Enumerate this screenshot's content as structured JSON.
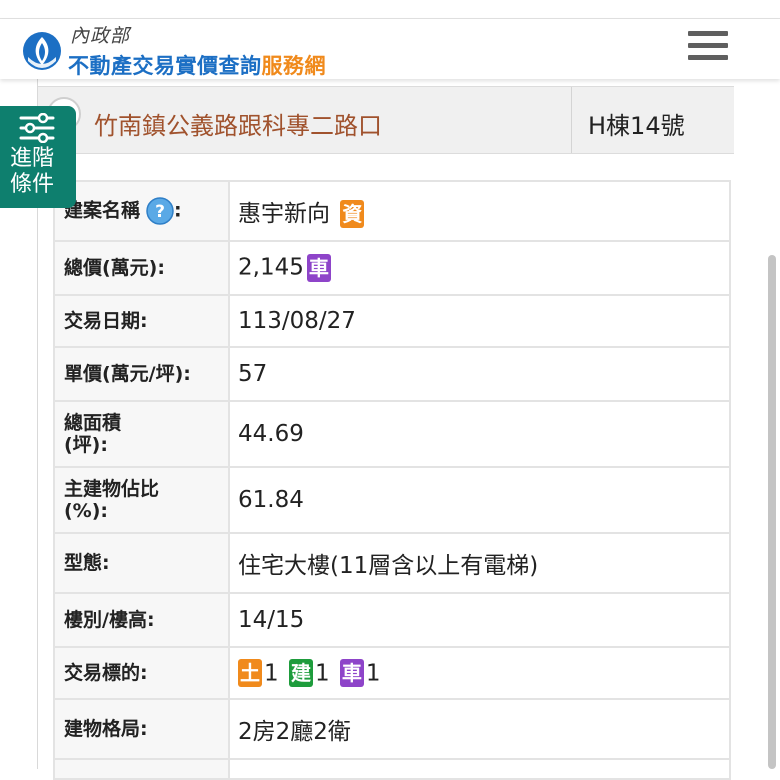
{
  "header": {
    "ministry": "內政部",
    "site_title_main": "不動產交易實價查詢",
    "site_title_accent": "服務網"
  },
  "advanced_filter": {
    "label": "進階條件"
  },
  "address_row": {
    "address": "竹南鎮公義路跟科專二路口",
    "unit": "H棟14號"
  },
  "details": {
    "project_name_label": "建案名稱",
    "project_name_colon": ":",
    "project_name_value": "惠宇新向",
    "project_badge": "資",
    "total_price_label": "總價(萬元):",
    "total_price_value": "2,145",
    "total_price_badge": "車",
    "date_label": "交易日期:",
    "date_value": "113/08/27",
    "unit_price_label": "單價(萬元/坪):",
    "unit_price_value": "57",
    "total_area_label": "總面積(坪):",
    "total_area_value": "44.69",
    "main_building_label": "主建物佔比(%):",
    "main_building_value": "61.84",
    "type_label": "型態:",
    "type_value": "住宅大樓(11層含以上有電梯)",
    "floor_label": "樓別/樓高:",
    "floor_value": "14/15",
    "target_label": "交易標的:",
    "targets": [
      {
        "badge": "土",
        "count": "1"
      },
      {
        "badge": "建",
        "count": "1"
      },
      {
        "badge": "車",
        "count": "1"
      }
    ],
    "layout_label": "建物格局:",
    "layout_value": "2房2廳2衛"
  },
  "colors": {
    "brand_blue": "#1c6fc4",
    "brand_orange": "#f08a1c",
    "filter_green": "#0e7f6e",
    "address_brown": "#a0522d",
    "badge_purple": "#8e44c9",
    "badge_green": "#1e9c3c"
  }
}
